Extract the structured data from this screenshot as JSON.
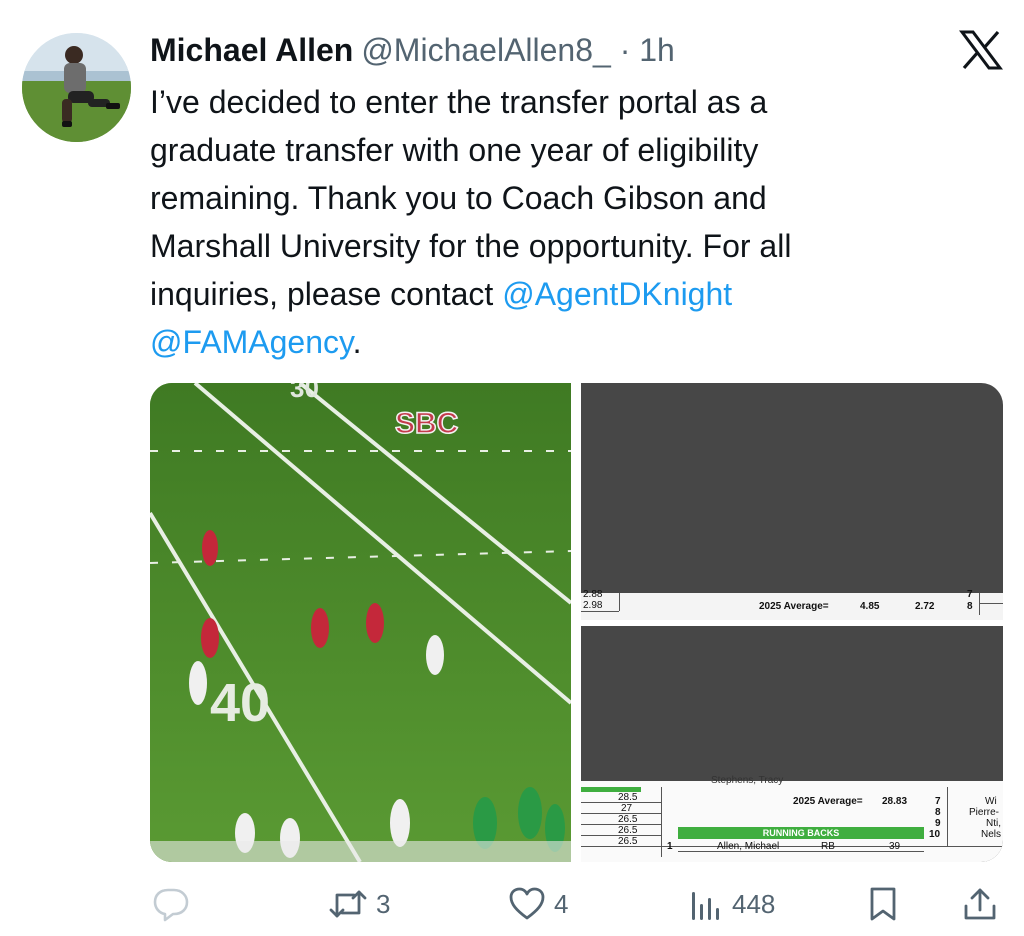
{
  "author": {
    "name": "Michael Allen",
    "handle": "@MichaelAllen8_",
    "separator": "·",
    "time": "1h"
  },
  "tweet": {
    "lines": [
      "I’ve decided to enter the transfer portal as a",
      "graduate transfer with one year of eligibility",
      "remaining. Thank you to Coach Gibson and",
      "Marshall University for the opportunity. For all",
      "inquiries, please contact "
    ],
    "mention1": "@AgentDKnight",
    "mention2": "@FAMAgency",
    "end": "."
  },
  "media": {
    "field_numbers": {
      "top": "30",
      "bottom": "40",
      "logo": "SBC"
    },
    "sheet_top": {
      "left_vals": [
        "2.88",
        "2.98"
      ],
      "avg_label": "2025 Average=",
      "val1": "4.85",
      "val2": "2.72",
      "right_nums": [
        "7",
        "8"
      ]
    },
    "sheet_bottom": {
      "left_vals": [
        "28.5",
        "27",
        "26.5",
        "26.5",
        "26.5"
      ],
      "avg_label": "2025 Average=",
      "avg_val": "28.83",
      "right_nums": [
        "7",
        "8",
        "9",
        "10"
      ],
      "right_names": [
        "Wi",
        "Pierre-",
        "Nti,",
        "Nels"
      ],
      "section": "RUNNING BACKS",
      "row_num": "1",
      "row_name": "Allen, Michael",
      "row_pos": "RB",
      "row_val": "39",
      "top_name": "Stephens, Tracy"
    }
  },
  "actions": {
    "reply_count": "",
    "retweet_count": "3",
    "like_count": "4",
    "views_count": "448"
  },
  "icons": [
    "reply-icon",
    "retweet-icon",
    "like-icon",
    "views-icon",
    "bookmark-icon",
    "share-icon",
    "x-logo-icon"
  ],
  "colors": {
    "link": "#1d9bf0",
    "muted": "#536471",
    "text": "#0f1419"
  }
}
